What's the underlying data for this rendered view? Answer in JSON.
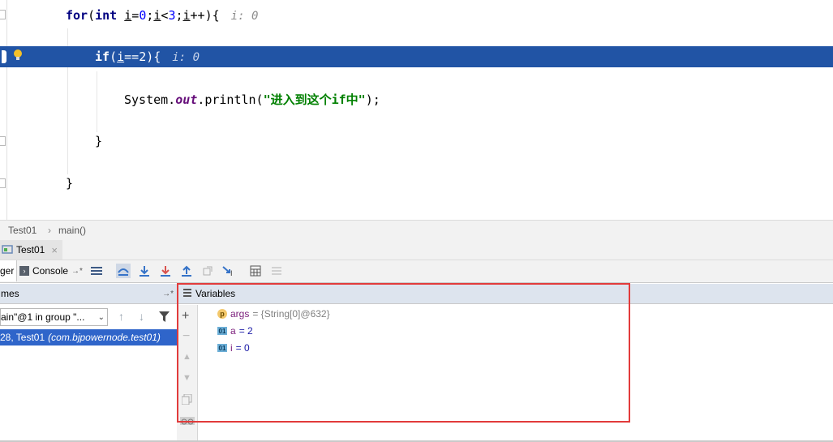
{
  "editor": {
    "line1": {
      "kw_for": "for",
      "kw_int": "int",
      "i1": "i",
      "eq": "=",
      "zero": "0",
      "semi1": ";",
      "i2": "i",
      "lt": "<",
      "three": "3",
      "semi2": ";",
      "i3": "i",
      "incr": "++){",
      "open_paren": "(",
      "hint": "i: 0"
    },
    "line2": {
      "kw_if": "if",
      "open": "(",
      "i": "i",
      "cmp": "==",
      "two": "2",
      "close": "){",
      "hint": "i: 0"
    },
    "line3": {
      "sys": "System.",
      "out": "out",
      "println": ".println(",
      "str": "\"进入到这个if中\"",
      "end": ");"
    },
    "line4": {
      "brace": "}"
    },
    "line5": {
      "brace": "}"
    }
  },
  "breadcrumb": {
    "file": "Test01",
    "sep": "›",
    "method": "main()"
  },
  "session": {
    "tab_label": "Test01",
    "close": "×"
  },
  "toolbar": {
    "debugger_tab": "ger",
    "console_tab": "Console",
    "console_pin": "→*"
  },
  "frames": {
    "header": "mes",
    "header_pin": "→*",
    "thread_select": "ain\"@1 in group \"...",
    "frame_row": "28, Test01",
    "frame_pkg": "(com.bjpowernode.test01)"
  },
  "variables": {
    "header": "Variables",
    "items": [
      {
        "badge": "p",
        "name": "args",
        "value": "= {String[0]@632}"
      },
      {
        "badge": "01",
        "name": "a",
        "value": "= 2"
      },
      {
        "badge": "01",
        "name": "i",
        "value": "= 0"
      }
    ]
  },
  "colors": {
    "highlight": "#2154a5",
    "annotation_box": "#e23b3b",
    "keyword": "#000080",
    "string": "#008000"
  }
}
